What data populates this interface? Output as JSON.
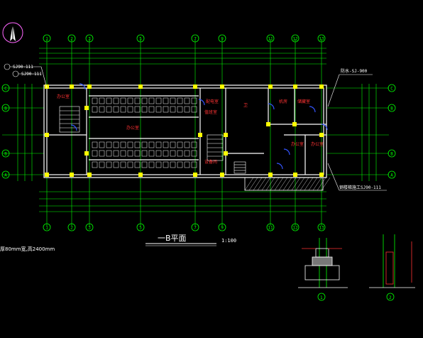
{
  "drawing": {
    "plan_title": "一B平面",
    "scale": "1:100",
    "note_left": "厚80mm宽,高2400mm",
    "note_detail_ref_1": "SJ90-111",
    "note_detail_ref_2": "SJ90-111",
    "note_right_ref": "防水-SJ-900",
    "note_bottom_right": "钢楼梯施工SJ90-111",
    "section_1_id": "1",
    "section_2_id": "2"
  },
  "grid_axes": {
    "top": [
      "1",
      "2",
      "3",
      "5",
      "7",
      "9",
      "11",
      "12",
      "13"
    ],
    "bottom": [
      "1",
      "2",
      "3",
      "5",
      "7",
      "9",
      "11",
      "12",
      "13"
    ],
    "left": [
      "C",
      "B",
      "B",
      "A"
    ],
    "right": [
      "C",
      "B",
      "B",
      "A"
    ]
  },
  "rooms": [
    {
      "id": "r1",
      "label": "办公室"
    },
    {
      "id": "r2",
      "label": "办公室"
    },
    {
      "id": "r3",
      "label": "配电室"
    },
    {
      "id": "r4",
      "label": "值班室"
    },
    {
      "id": "r5",
      "label": "卫"
    },
    {
      "id": "r6",
      "label": "机房"
    },
    {
      "id": "r7",
      "label": "储藏室"
    },
    {
      "id": "r8",
      "label": "设备间"
    },
    {
      "id": "r9",
      "label": "办公室"
    },
    {
      "id": "r10",
      "label": "办公室"
    }
  ],
  "colors": {
    "background": "#000000",
    "grid": "#00ff00",
    "walls": "#ffffff",
    "columns": "#ffff00",
    "doors": "#0000ff",
    "text_red": "#ff3333",
    "dimensions": "#00ff00",
    "callouts": "#ffffff"
  },
  "icons": {
    "north_arrow": "north-arrow-icon"
  }
}
